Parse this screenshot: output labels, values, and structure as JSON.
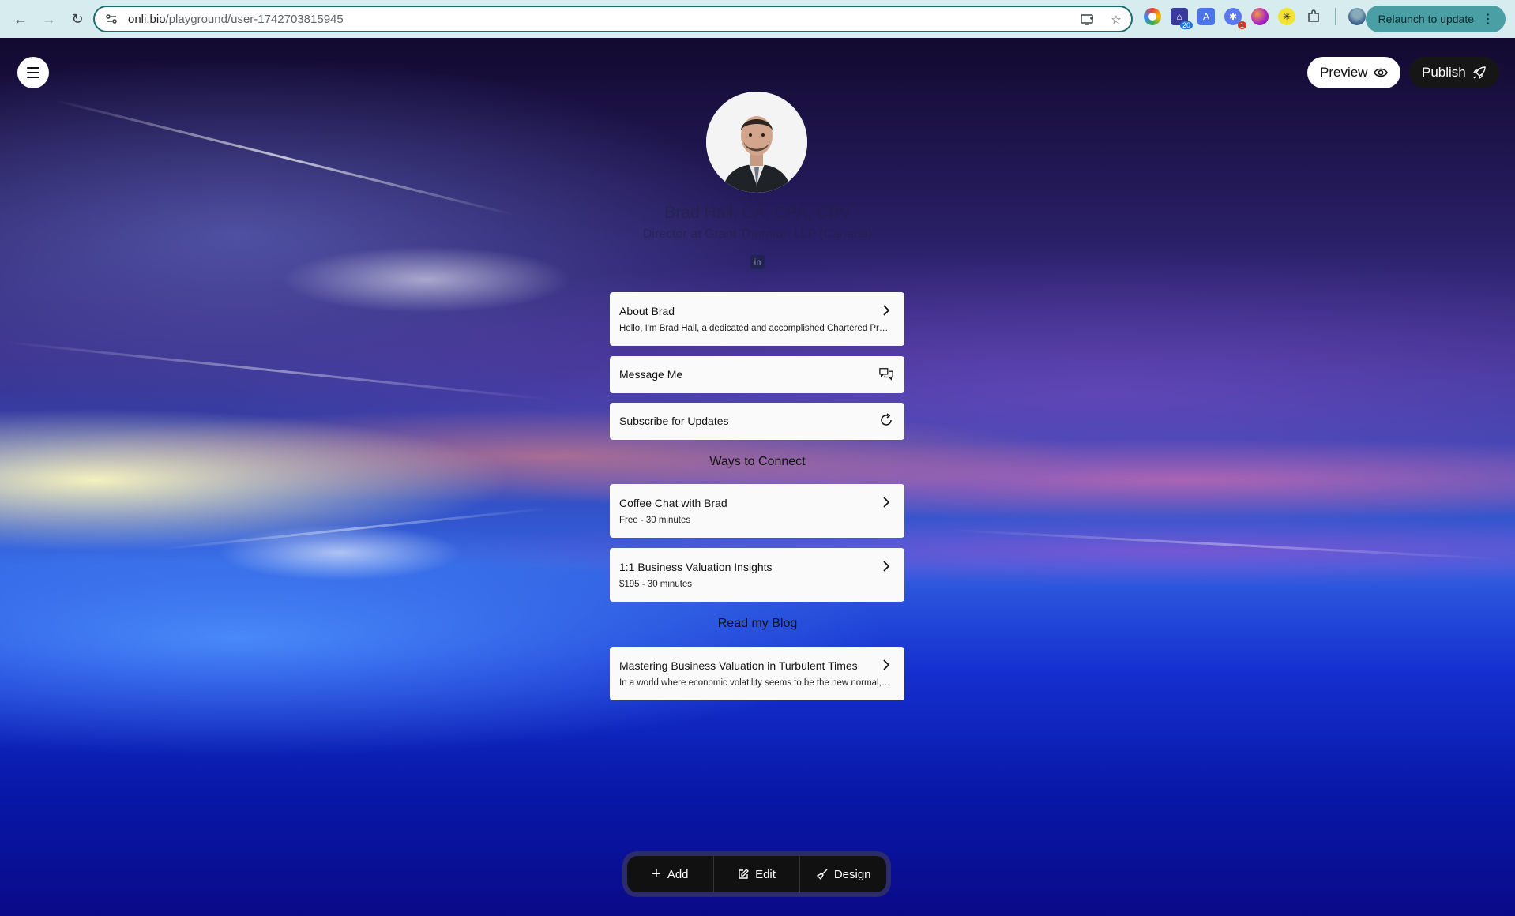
{
  "browser": {
    "url_host": "onli.bio",
    "url_path": "/playground/user-1742703815945",
    "relaunch_label": "Relaunch to update",
    "extension_badges": [
      "20",
      "1"
    ]
  },
  "header": {
    "preview_label": "Preview",
    "publish_label": "Publish"
  },
  "profile": {
    "name": "Brad Hall, CA, CPA, CBV",
    "title": "Director at Grant Thornton LLP (Canada)",
    "social_icon": "linkedin-icon"
  },
  "cards": {
    "about": {
      "title": "About Brad",
      "subtitle": "Hello, I'm Brad Hall, a dedicated and accomplished Chartered Professional Accountant"
    },
    "message": {
      "title": "Message Me"
    },
    "subscribe": {
      "title": "Subscribe for Updates"
    }
  },
  "connect": {
    "heading": "Ways to Connect",
    "items": [
      {
        "title": "Coffee Chat with Brad",
        "subtitle": "Free - 30 minutes"
      },
      {
        "title": "1:1 Business Valuation Insights",
        "subtitle": "$195 - 30 minutes"
      }
    ]
  },
  "blog": {
    "heading": "Read my Blog",
    "items": [
      {
        "title": "Mastering Business Valuation in Turbulent Times",
        "subtitle": "In a world where economic volatility seems to be the new normal, business owners are"
      }
    ]
  },
  "toolbar": {
    "add_label": "Add",
    "edit_label": "Edit",
    "design_label": "Design"
  },
  "colors": {
    "browser_bar": "#d7ecef",
    "relaunch_bg": "#4a9fa5",
    "card_bg": "#fafafa",
    "publish_bg": "#161616"
  }
}
